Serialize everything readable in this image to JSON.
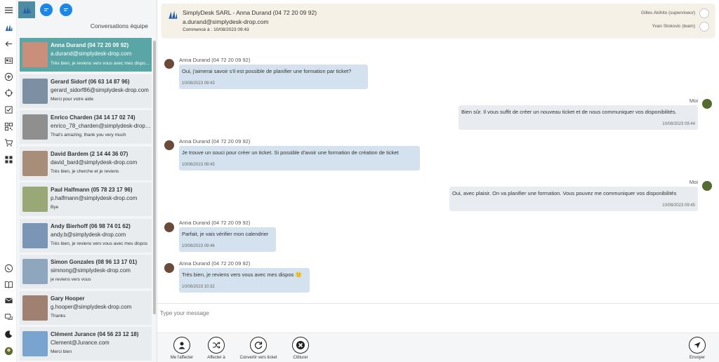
{
  "rail": {
    "icons": [
      "menu-icon",
      "app-logo-icon",
      "back-icon",
      "id-card-icon",
      "add-circle-icon",
      "crosshair-icon",
      "checkbox-icon",
      "qr-code-icon",
      "cart-icon",
      "grid-icon",
      "whatsapp-icon",
      "book-icon",
      "inbox-icon",
      "chat-bubbles-icon",
      "dark-mode-icon",
      "user-avatar"
    ]
  },
  "panel": {
    "title": "Conversations équipe",
    "conversations": [
      {
        "name": "Anna Durand (04 72 20 09 92)",
        "email": "a.durand@simplydesk-drop.com",
        "last": "Très bien, je reviens vers vous avec mes dispos 🙂",
        "active": true
      },
      {
        "name": "Gerard Sidorf (06 63 14 87 96)",
        "email": "gerard_sidorf86@simplydesk-drop.com",
        "last": "Merci pour votre aide"
      },
      {
        "name": "Enrico Charden (34 14 17 02 74)",
        "email": "enrico_78_charden@simplydesk-drop.com",
        "last": "That's amazing, thank you very much"
      },
      {
        "name": "David Bardem (2 14 44 36 07)",
        "email": "david_bard@simplydesk-drop.com",
        "last": "Très bien, je cherche et je reviens"
      },
      {
        "name": "Paul Halfmann (05 78 23 17 96)",
        "email": "p.halfmann@simplydesk-drop.com",
        "last": "Bye"
      },
      {
        "name": "Andy Bierhoff (06 98 74 01 62)",
        "email": "andy.b@simplydesk-drop.com",
        "last": "Très bien, je reviens vers vous avec mes dispos"
      },
      {
        "name": "Simon Gonzales (08 96 13 17 01)",
        "email": "simnong@simplydesk-drop.com",
        "last": "je reviens vers vous"
      },
      {
        "name": "Gary Hooper",
        "email": "g.hooper@simplydesk-drop.com",
        "last": "Thanks"
      },
      {
        "name": "Clément Jurance (04 56 23 12 18)",
        "email": "Clement@Jurance.com",
        "last": "Merci bien"
      }
    ]
  },
  "header": {
    "title": "SimplyDesk SARL - Anna Durand (04 72 20 09 92)",
    "email": "a.durand@simplydesk-drop.com",
    "started": "Commencé à : 10/08/2023 09:43",
    "agents": [
      "Gilles Akihito (superviseur)",
      "Yvan Stokovic (team)"
    ]
  },
  "messages": [
    {
      "dir": "in",
      "author": "Anna Durand (04 72 20 09 92)",
      "text": "Oui, j'aimerai savoir s'il est possible de planifier une formation par ticket?",
      "time": "10/08/2023 09:43"
    },
    {
      "dir": "out",
      "author": "Moi",
      "text": "Bien sûr. Il vous suffit de créer un nouveau ticket et de nous communiquer vos disponibilités.",
      "time": "10/08/2023 09:44"
    },
    {
      "dir": "in",
      "author": "Anna Durand (04 72 20 09 92)",
      "text": "Je trouve un souci pour créer un ticket. Si possible d'avoir une formation de création de ticket",
      "time": "10/08/2023 09:45"
    },
    {
      "dir": "out",
      "author": "Moi",
      "text": "Oui, avec plaisir. On va planifier une formation. Vous pouvez me communiquer vos disponibilités",
      "time": "10/08/2023 09:45"
    },
    {
      "dir": "in",
      "author": "Anna Durand (04 72 20 09 92)",
      "text": "Parfait, je vais vérifier mon calendrier",
      "time": "10/08/2023 09:46"
    },
    {
      "dir": "in",
      "author": "Anna Durand (04 72 20 09 92)",
      "text": "Très bien, je reviens vers vous avec mes dispos 🙂",
      "time": "10/08/2023 10:32"
    }
  ],
  "composer": {
    "placeholder": "Type your message"
  },
  "actions": {
    "assign_me": "Me l'affecter",
    "assign_to": "Affecter à",
    "convert": "Convertir vers ticket",
    "close": "Clôturer",
    "send": "Envoyer"
  }
}
